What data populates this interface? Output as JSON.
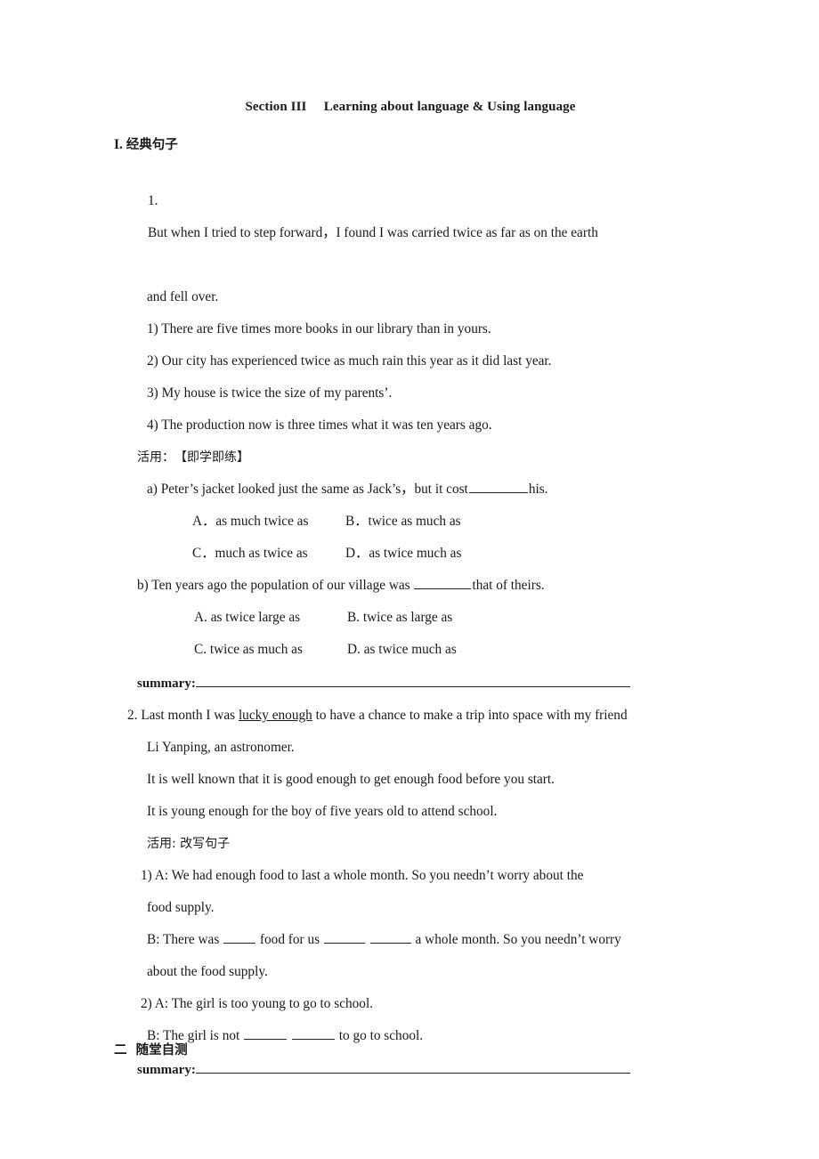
{
  "document": {
    "title": "Section III     Learning about language & Using language",
    "section_1": {
      "heading_marker": "I.",
      "heading_cn": "经典句子",
      "item1": {
        "number": "1.",
        "text_line1": "But when I tried to step forward，I found I was carried twice as far as on the earth",
        "text_line2": "and fell over.",
        "examples": [
          "1) There are five times more books in our library than in yours.",
          "2) Our city has experienced twice as much rain this year as it did last year.",
          "3) My house is twice the size of my parents’.",
          "4) The production now is three times what it was ten years ago."
        ],
        "practice_label": "活用：　【即学即练】",
        "question_a": {
          "prefix": "a) Peter’s jacket looked just the same as Jack’s，but it cost",
          "suffix": "his.",
          "options": [
            {
              "label": "A．",
              "text": "as much twice as"
            },
            {
              "label": "B．",
              "text": "twice as much as"
            },
            {
              "label": "C．",
              "text": "much as twice as"
            },
            {
              "label": "D．",
              "text": "as twice much as"
            }
          ]
        },
        "question_b": {
          "prefix": "b) Ten years ago the population of our village was ",
          "suffix": "that of theirs.",
          "options": [
            {
              "label": "A.",
              "text": "as twice large as"
            },
            {
              "label": "B.",
              "text": "twice as large as"
            },
            {
              "label": "C.",
              "text": "twice as much as"
            },
            {
              "label": "D.",
              "text": "as twice much as"
            }
          ]
        },
        "summary_label": "summary:"
      },
      "item2": {
        "number": "2.",
        "text_before": "Last month I was ",
        "underlined": "lucky enough",
        "text_after": " to have a chance to make a trip into space with my friend",
        "text_line2": "Li Yanping, an astronomer.",
        "examples": [
          "It is well known that it is good enough to get enough food before you start.",
          "It is young enough for the boy of five years old to attend school."
        ],
        "practice_label": "活用: 改写句子",
        "dialogue1": {
          "a_line1": "1) A: We had enough food to last a whole month. So you needn’t worry about the",
          "a_line2": "food supply.",
          "b_prefix": "B: There was ",
          "b_mid1": " food for us ",
          "b_mid2": " ",
          "b_suffix": " a whole month. So you needn’t worry",
          "b_line2": "about the food supply."
        },
        "dialogue2": {
          "a_line": "2) A: The girl is too young to go to school.",
          "b_prefix": "B: The girl is not ",
          "b_mid": " ",
          "b_suffix": " to go to school."
        },
        "summary_label": "summary:"
      }
    },
    "section_2": {
      "heading": "二  随堂自测"
    }
  }
}
